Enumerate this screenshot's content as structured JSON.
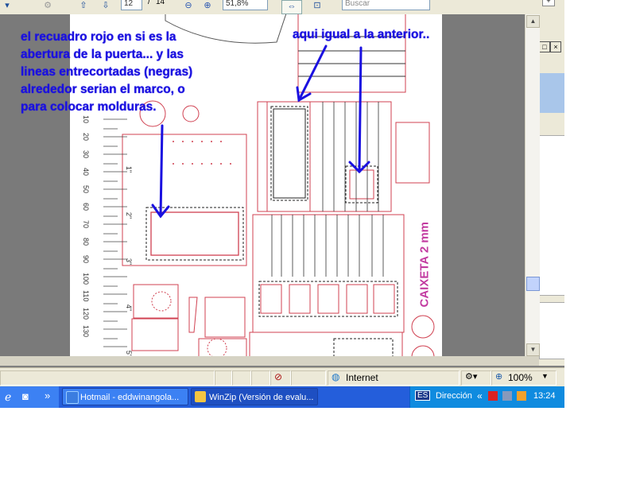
{
  "toolbar": {
    "page_current": "12",
    "page_sep": "/",
    "page_total": "14",
    "zoom": "51,8%",
    "search_placeholder": "Buscar"
  },
  "document": {
    "ruler_labels": [
      "10",
      "20",
      "30",
      "40",
      "50",
      "60",
      "70",
      "80",
      "90",
      "100",
      "110",
      "120",
      "130"
    ],
    "side_marks": [
      "1\"",
      "2\"",
      "3\"",
      "4\"",
      "5\""
    ],
    "vertical_text": "CAIXETA 2 mm"
  },
  "annotations": {
    "left_note": [
      "el recuadro rojo en si es la",
      "abertura de la puerta... y las",
      "lineas entrecortadas (negras)",
      "alrededor serian el marco, o",
      "para colocar molduras."
    ],
    "right_note": "aqui igual a la anterior.."
  },
  "statusbar": {
    "zone": "Internet",
    "zoom": "100%"
  },
  "taskbar": {
    "chevron": "»",
    "tasks": [
      "Hotmail - eddwinangola...",
      "WinZip (Versión de evalu..."
    ],
    "lang": "ES",
    "address_label": "Dirección",
    "tray_chevron": "«",
    "clock": "13:24"
  },
  "colors": {
    "annotation": "#1a10e0",
    "drawing_red": "#d04050",
    "taskbar": "#245edb"
  }
}
